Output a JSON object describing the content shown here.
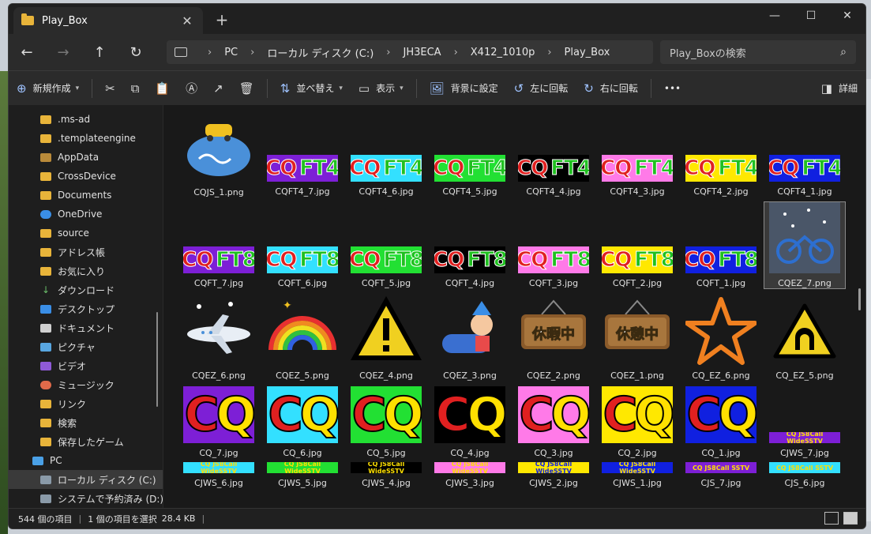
{
  "window": {
    "tab_title": "Play_Box",
    "new_tab": "+",
    "close_tab": "✕",
    "controls": {
      "minimize": "—",
      "maximize": "☐",
      "close": "✕"
    }
  },
  "nav": {
    "back": "←",
    "forward": "→",
    "up": "↑",
    "refresh": "↻",
    "breadcrumb": [
      "PC",
      "ローカル ディスク (C:)",
      "JH3ECA",
      "X412_1010p",
      "Play_Box"
    ],
    "search_placeholder": "Play_Boxの検索"
  },
  "commands": {
    "new": "新規作成",
    "sort": "並べ替え",
    "view": "表示",
    "set_background": "背景に設定",
    "rotate_left": "左に回転",
    "rotate_right": "右に回転",
    "more": "•••",
    "details": "詳細"
  },
  "sidebar": {
    "items": [
      {
        "label": ".ms-ad",
        "icon": "folder"
      },
      {
        "label": ".templateengine",
        "icon": "folder"
      },
      {
        "label": "AppData",
        "icon": "folder2"
      },
      {
        "label": "CrossDevice",
        "icon": "folder"
      },
      {
        "label": "Documents",
        "icon": "folder"
      },
      {
        "label": "OneDrive",
        "icon": "cloud"
      },
      {
        "label": "source",
        "icon": "folder"
      },
      {
        "label": "アドレス帳",
        "icon": "folder"
      },
      {
        "label": "お気に入り",
        "icon": "folder"
      },
      {
        "label": "ダウンロード",
        "icon": "dl"
      },
      {
        "label": "デスクトップ",
        "icon": "desk"
      },
      {
        "label": "ドキュメント",
        "icon": "doc"
      },
      {
        "label": "ピクチャ",
        "icon": "pic"
      },
      {
        "label": "ビデオ",
        "icon": "vid"
      },
      {
        "label": "ミュージック",
        "icon": "mus"
      },
      {
        "label": "リンク",
        "icon": "folder"
      },
      {
        "label": "検索",
        "icon": "folder"
      },
      {
        "label": "保存したゲーム",
        "icon": "folder"
      },
      {
        "label": "PC",
        "icon": "pc"
      },
      {
        "label": "ローカル ディスク (C:)",
        "icon": "drive"
      },
      {
        "label": "システムで予約済み (D:)",
        "icon": "drive"
      }
    ]
  },
  "files": {
    "row1": [
      "CQJS_1.png",
      "CQFT4_7.jpg",
      "CQFT4_6.jpg",
      "CQFT4_5.jpg",
      "CQFT4_4.jpg",
      "CQFT4_3.jpg",
      "CQFT4_2.jpg",
      "CQFT4_1.jpg"
    ],
    "row2": [
      "CQFT_7.jpg",
      "CQFT_6.jpg",
      "CQFT_5.jpg",
      "CQFT_4.jpg",
      "CQFT_3.jpg",
      "CQFT_2.jpg",
      "CQFT_1.jpg",
      "CQEZ_7.png"
    ],
    "row3": [
      "CQEZ_6.png",
      "CQEZ_5.png",
      "CQEZ_4.png",
      "CQEZ_3.png",
      "CQEZ_2.png",
      "CQEZ_1.png",
      "CQ_EZ_6.png",
      "CQ_EZ_5.png"
    ],
    "row4": [
      "CQ_7.jpg",
      "CQ_6.jpg",
      "CQ_5.jpg",
      "CQ_4.jpg",
      "CQ_3.jpg",
      "CQ_2.jpg",
      "CQ_1.jpg",
      "CJWS_7.jpg"
    ],
    "row5": [
      "CJWS_6.jpg",
      "CJWS_5.jpg",
      "CJWS_4.jpg",
      "CJWS_3.jpg",
      "CJWS_2.jpg",
      "CJWS_1.jpg",
      "CJS_7.jpg",
      "CJS_6.jpg"
    ],
    "banner_ft4": {
      "c": "CQ",
      "f": "FT4"
    },
    "banner_ft8": {
      "c": "CQ",
      "f": "FT8"
    },
    "cq_text": {
      "c": "C",
      "q": "Q"
    },
    "strip_jws": "CQ JS8Call WideSSTV",
    "strip_js": "CQ JS8Call SSTV",
    "sign_holiday": "休暇中",
    "sign_rest": "休憩中"
  },
  "colors": {
    "ft4_bgs": [
      "#7d1fd6",
      "#33e0ff",
      "#22e033",
      "#000000",
      "#ff7ae8",
      "#ffe800",
      "#1020e0"
    ],
    "cq_bgs": [
      "#7d1fd6",
      "#33e0ff",
      "#22e033",
      "#000000",
      "#ff7ae8",
      "#ffe800",
      "#1020e0"
    ]
  },
  "status": {
    "count": "544 個の項目",
    "selected": "1 個の項目を選択",
    "size": "28.4 KB"
  }
}
